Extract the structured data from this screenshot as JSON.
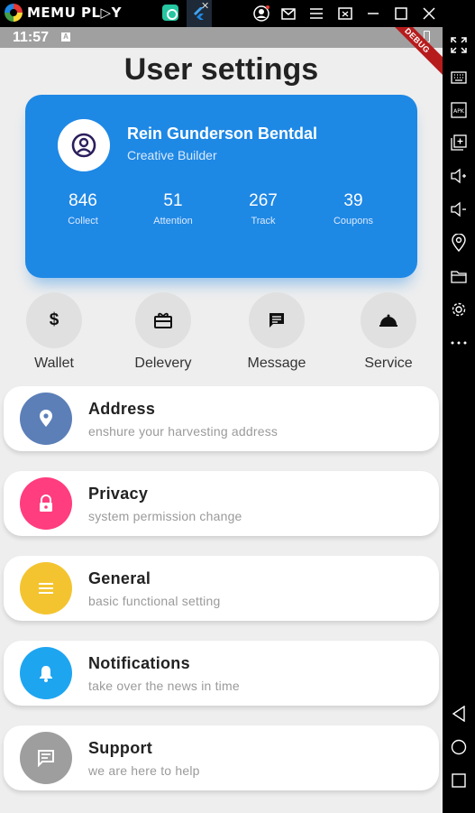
{
  "emulator": {
    "logo_text": "MEMU PL▷Y",
    "tab_close": "✕",
    "window_buttons": [
      "account-icon",
      "mail-icon",
      "menu-icon",
      "screen-icon",
      "minimize-icon",
      "maximize-icon",
      "close-icon"
    ],
    "toolbar_icons": [
      "fullscreen-icon",
      "keyboard-icon",
      "apk-icon",
      "add-window-icon",
      "volume-up-icon",
      "volume-down-icon",
      "location-icon",
      "folder-icon",
      "settings-icon",
      "more-icon",
      "back-icon",
      "home-icon",
      "recents-icon"
    ],
    "apk_label": "APK"
  },
  "status_bar": {
    "time": "11:57",
    "notification_badge": "A",
    "debug_label": "DEBUG"
  },
  "page": {
    "title": "User settings"
  },
  "profile": {
    "name": "Rein Gunderson Bentdal",
    "role": "Creative Builder",
    "stats": [
      {
        "value": "846",
        "label": "Collect"
      },
      {
        "value": "51",
        "label": "Attention"
      },
      {
        "value": "267",
        "label": "Track"
      },
      {
        "value": "39",
        "label": "Coupons"
      }
    ]
  },
  "quick_actions": [
    {
      "label": "Wallet",
      "icon": "dollar-icon",
      "glyph": "$"
    },
    {
      "label": "Delevery",
      "icon": "gift-card-icon"
    },
    {
      "label": "Message",
      "icon": "message-icon"
    },
    {
      "label": "Service",
      "icon": "room-service-icon"
    }
  ],
  "menu": [
    {
      "title": "Address",
      "subtitle": "enshure your harvesting address",
      "icon": "location-pin-icon",
      "color": "#5c7fb8"
    },
    {
      "title": "Privacy",
      "subtitle": "system permission change",
      "icon": "lock-icon",
      "color": "#ff3d7f"
    },
    {
      "title": "General",
      "subtitle": "basic functional setting",
      "icon": "menu-lines-icon",
      "color": "#f4c430"
    },
    {
      "title": "Notifications",
      "subtitle": "take over the news in time",
      "icon": "bell-icon",
      "color": "#1ea5f0"
    },
    {
      "title": "Support",
      "subtitle": "we are here to help",
      "icon": "chat-icon",
      "color": "#9e9e9e"
    }
  ],
  "colors": {
    "card_blue": "#1e88e5",
    "background": "#eeeeee",
    "avatar_icon": "#2b1e5c"
  }
}
